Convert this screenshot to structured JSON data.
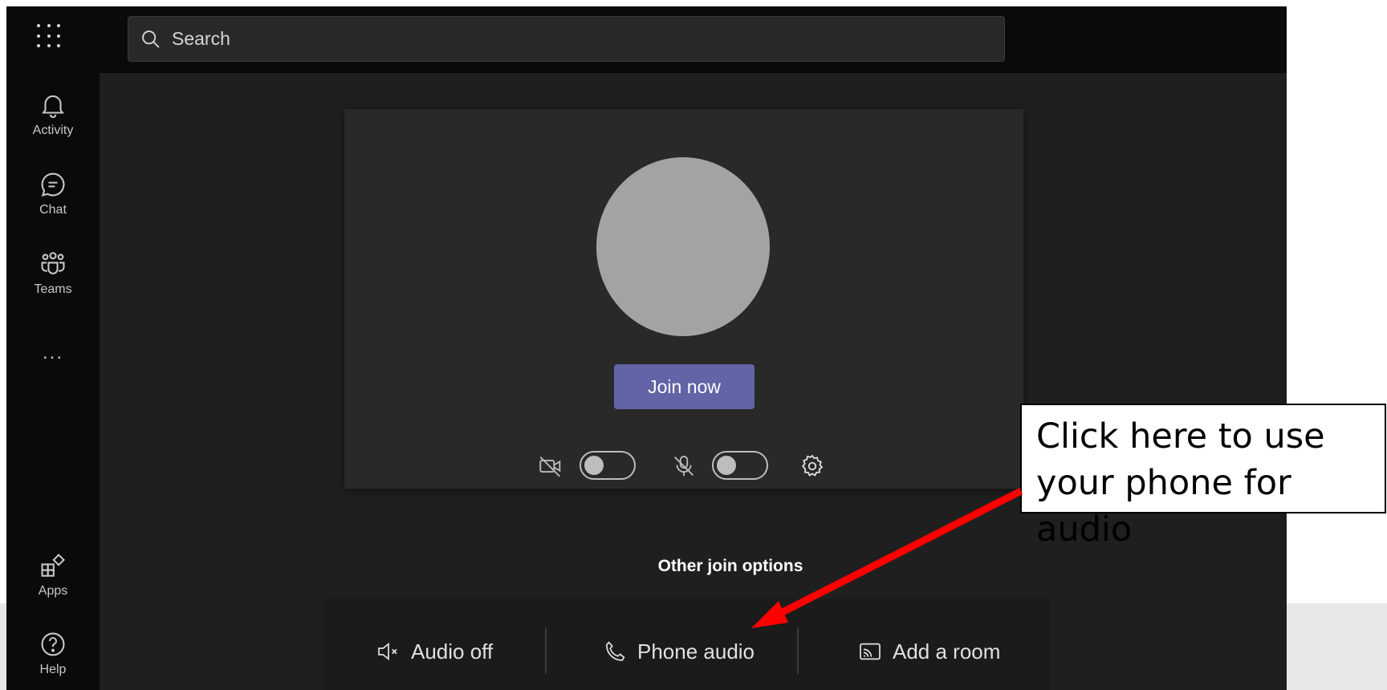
{
  "search": {
    "placeholder": "Search"
  },
  "rail": {
    "items": [
      {
        "label": "Activity",
        "icon": "bell-icon"
      },
      {
        "label": "Chat",
        "icon": "chat-icon"
      },
      {
        "label": "Teams",
        "icon": "teams-icon"
      },
      {
        "label": "Apps",
        "icon": "apps-icon"
      },
      {
        "label": "Help",
        "icon": "help-icon"
      }
    ],
    "more_label": "..."
  },
  "preview": {
    "join_label": "Join now",
    "camera_on": false,
    "mic_on": false
  },
  "other_options": {
    "title": "Other join options",
    "items": [
      {
        "label": "Audio off",
        "icon": "speaker-off-icon"
      },
      {
        "label": "Phone audio",
        "icon": "phone-icon"
      },
      {
        "label": "Add a room",
        "icon": "cast-icon"
      }
    ]
  },
  "callout": {
    "line1": "Click here to use",
    "line2": "your phone for audio"
  },
  "colors": {
    "accent": "#6264a7",
    "arrow": "#ff0000"
  }
}
